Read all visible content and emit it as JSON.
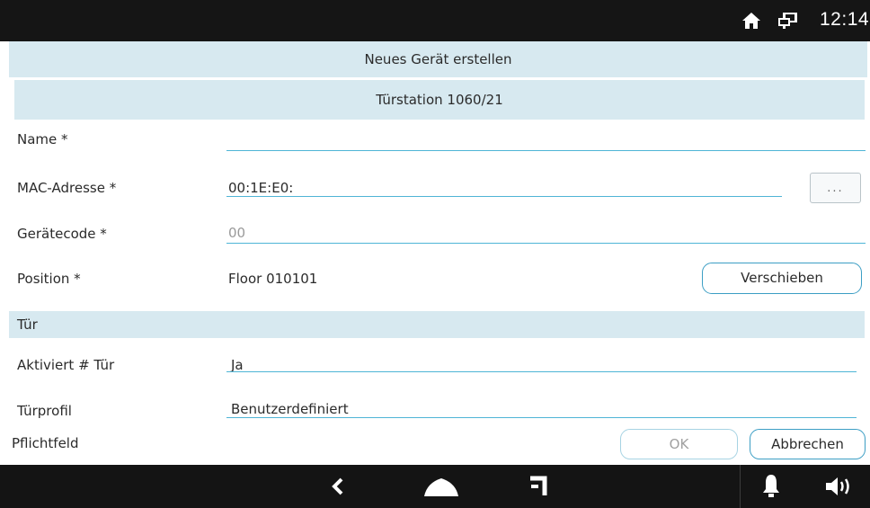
{
  "status": {
    "time": "12:14",
    "icons": [
      "home-icon",
      "network-icon"
    ]
  },
  "dialog": {
    "title": "Neues Gerät erstellen",
    "subtitle": "Türstation 1060/21"
  },
  "fields": {
    "name": {
      "label": "Name *",
      "value": ""
    },
    "mac": {
      "label": "MAC-Adresse *",
      "value": "00:1E:E0:",
      "button_label": "..."
    },
    "device_code": {
      "label": "Gerätecode *",
      "placeholder": "00"
    },
    "position": {
      "label": "Position *",
      "value": "Floor 010101",
      "button_label": "Verschieben"
    }
  },
  "door_section": {
    "title": "Tür",
    "activated": {
      "label": "Aktiviert # Tür",
      "value": "Ja"
    },
    "profile": {
      "label": "Türprofil",
      "value": "Benutzerdefiniert"
    }
  },
  "footer": {
    "required_note": "Pflichtfeld",
    "ok_label": "OK",
    "cancel_label": "Abbrechen"
  },
  "navbar": {
    "icons": [
      "back-icon",
      "home-icon",
      "recent-apps-icon",
      "bell-icon",
      "speaker-icon"
    ]
  },
  "colors": {
    "accent": "#4fb5d6",
    "header_bg": "#d7e9f0",
    "bar_bg": "#141414"
  }
}
